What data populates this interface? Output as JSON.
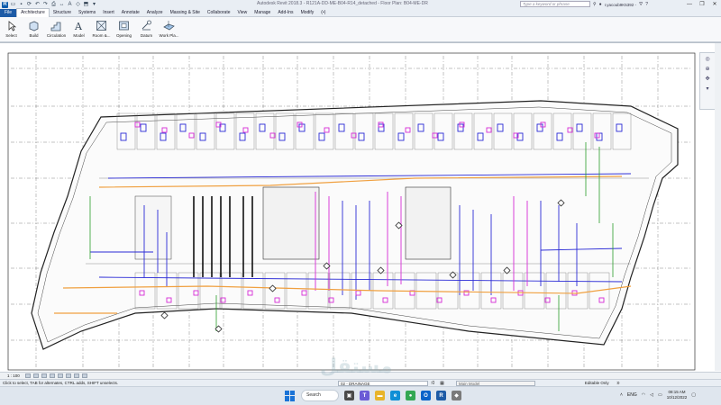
{
  "titlebar": {
    "title": "Autodesk Revit 2018.3 -    R121A-DD-ME-B04-R14_detached - Floor Plan: B04-ME-DR",
    "search_placeholder": "Type a keyword or phrase",
    "user": "r.yacoub9K5392 -",
    "qat_icons": [
      "revit-logo",
      "open-icon",
      "save-icon",
      "sync-icon",
      "undo-icon",
      "redo-icon",
      "print-icon",
      "measure-icon",
      "tag-icon",
      "3d-icon",
      "section-icon",
      "close-icon"
    ]
  },
  "menu": {
    "tabs": [
      "File",
      "Architecture",
      "Structure",
      "Systems",
      "Insert",
      "Annotate",
      "Analyze",
      "Massing & Site",
      "Collaborate",
      "View",
      "Manage",
      "Add-Ins",
      "Modify",
      "(•)"
    ],
    "active": "Architecture"
  },
  "ribbon": {
    "buttons": [
      {
        "label": "Select",
        "icon": "cursor-icon"
      },
      {
        "label": "Build",
        "icon": "wall-icon"
      },
      {
        "label": "Circulation",
        "icon": "stair-icon"
      },
      {
        "label": "Model",
        "icon": "model-text-icon"
      },
      {
        "label": "Room &...",
        "icon": "room-icon"
      },
      {
        "label": "Opening",
        "icon": "opening-icon"
      },
      {
        "label": "Datum",
        "icon": "datum-icon"
      },
      {
        "label": "Work Pla...",
        "icon": "workplane-icon"
      }
    ]
  },
  "viewbar": {
    "scale": "1 : 100"
  },
  "statusbar": {
    "message": "Click to select, TAB for alternates, CTRL adds, SHIFT unselects.",
    "workset": "02 - DRAINAGE",
    "workset_count": ":0",
    "model": "Main Model",
    "editable": "Editable Only",
    "filter_count": ":0"
  },
  "taskbar": {
    "search": "Search",
    "lang": "ENG",
    "time": "08:15 AM",
    "date": "10/12/2022"
  },
  "colors": {
    "accent": "#1d5ba6",
    "duct_blue": "#2b2bd6",
    "pipe_magenta": "#d62bd6",
    "pipe_orange": "#f0a040",
    "pipe_green": "#2a9d2a"
  },
  "watermark": "مستقل"
}
